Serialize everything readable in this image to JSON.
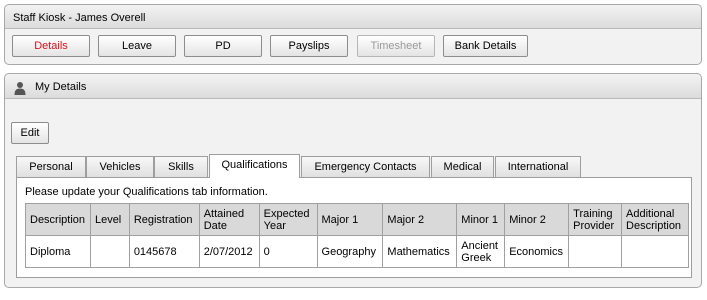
{
  "kiosk": {
    "title": "Staff Kiosk - James Overell",
    "nav_buttons": [
      {
        "label": "Details",
        "state": "active"
      },
      {
        "label": "Leave",
        "state": "normal"
      },
      {
        "label": "PD",
        "state": "normal"
      },
      {
        "label": "Payslips",
        "state": "normal"
      },
      {
        "label": "Timesheet",
        "state": "disabled"
      },
      {
        "label": "Bank Details",
        "state": "normal"
      }
    ]
  },
  "details_panel": {
    "title": "My Details",
    "icon": "person-icon",
    "edit_label": "Edit",
    "tabs": [
      {
        "label": "Personal"
      },
      {
        "label": "Vehicles"
      },
      {
        "label": "Skills"
      },
      {
        "label": "Qualifications",
        "selected": true
      },
      {
        "label": "Emergency Contacts"
      },
      {
        "label": "Medical"
      },
      {
        "label": "International"
      }
    ],
    "message": "Please update your Qualifications tab information.",
    "table": {
      "headers": [
        "Description",
        "Level",
        "Registration",
        "Attained Date",
        "Expected Year",
        "Major 1",
        "Major 2",
        "Minor 1",
        "Minor 2",
        "Training Provider",
        "Additional Description"
      ],
      "rows": [
        [
          "Diploma",
          "",
          "0145678",
          "2/07/2012",
          "0",
          "Geography",
          "Mathematics",
          "Ancient Greek",
          "Economics",
          "",
          ""
        ]
      ]
    }
  },
  "colors": {
    "active_button_text": "#d8141c",
    "disabled_button_text": "#9a9a9a",
    "panel_background": "#f2f2f2",
    "table_header_background": "#d9d9d9"
  }
}
